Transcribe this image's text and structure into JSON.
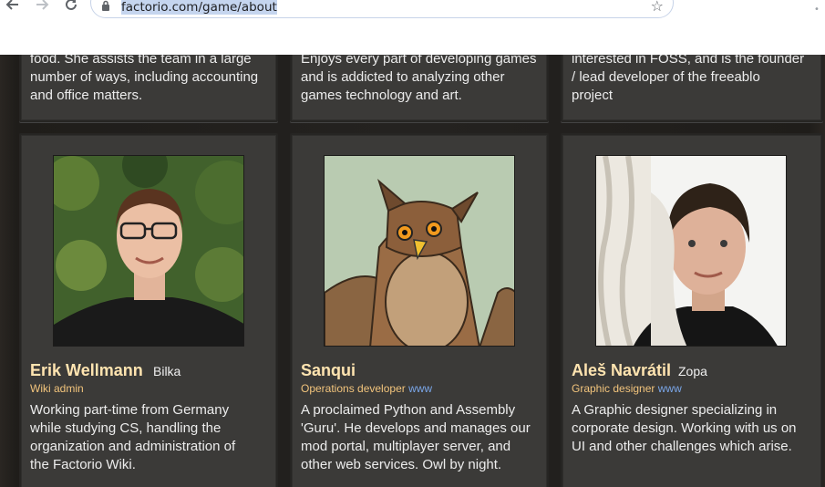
{
  "browser": {
    "url": "factorio.com/game/about",
    "back_icon": "arrow-left-icon",
    "forward_icon": "arrow-right-icon",
    "reload_icon": "reload-icon",
    "lock_icon": "lock-icon",
    "bookmark_icon": "star-icon"
  },
  "top_cards": [
    {
      "lines": [
        "food. She assists the team in a large",
        "number of ways, including accounting",
        "and office matters."
      ]
    },
    {
      "lines": [
        "Enjoys every part of developing games",
        "and is addicted to analyzing other",
        "games technology and art."
      ]
    },
    {
      "lines": [
        "interested in FOSS, and is the founder",
        "/ lead developer of the freeablo",
        "project"
      ]
    }
  ],
  "team": [
    {
      "name": "Erik Wellmann",
      "nick": "Bilka",
      "role": "Wiki admin",
      "link": "",
      "bio": [
        "Working part-time from Germany",
        "while studying CS, handling the",
        "organization and administration of",
        "the Factorio Wiki."
      ]
    },
    {
      "name": "Sanqui",
      "nick": "",
      "role": "Operations developer",
      "link": "www",
      "bio": [
        "A proclaimed Python and Assembly",
        "'Guru'. He develops and manages our",
        "mod portal, multiplayer server, and",
        "other web services. Owl by night."
      ]
    },
    {
      "name": "Aleš Navrátil",
      "nick": "Zopa",
      "role": "Graphic designer",
      "link": "www",
      "bio": [
        "A Graphic designer specializing in",
        "corporate design. Working with us on",
        "UI and other challenges which arise."
      ]
    }
  ]
}
